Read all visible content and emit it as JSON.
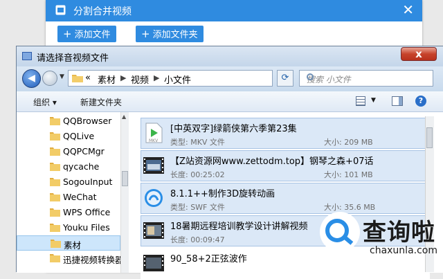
{
  "app": {
    "title": "分割合并视频",
    "close": "✕",
    "buttons": {
      "add_file": "添加文件",
      "add_folder": "添加文件夹",
      "plus": "+"
    }
  },
  "dialog": {
    "title": "请选择音视频文件",
    "close": "x",
    "nav": {
      "overflow": "«",
      "breadcrumb": [
        "素材",
        "视频",
        "小文件"
      ],
      "search_placeholder": "搜索 小文件"
    },
    "toolbar": {
      "organize": "组织 ▾",
      "new_folder": "新建文件夹",
      "help": "?"
    },
    "sidebar": {
      "items": [
        {
          "label": "QQBrowser"
        },
        {
          "label": "QQLive"
        },
        {
          "label": "QQPCMgr"
        },
        {
          "label": "qycache"
        },
        {
          "label": "SogouInput"
        },
        {
          "label": "WeChat"
        },
        {
          "label": "WPS Office"
        },
        {
          "label": "Youku Files"
        },
        {
          "label": "素材",
          "selected": true
        },
        {
          "label": "迅捷视频转换器"
        }
      ]
    },
    "files": [
      {
        "name": "[中英双字]绿箭侠第六季第23集",
        "meta": "类型: MKV 文件",
        "size": "大小: 209 MB",
        "thumb": "mkv-icon"
      },
      {
        "name": "【Z站资源网www.zettodm.top】钢琴之森+07话",
        "meta": "长度: 00:25:02",
        "size": "大小: 101 MB",
        "thumb": "video-thumbnail"
      },
      {
        "name": "8.1.1++制作3D旋转动画",
        "meta": "类型: SWF 文件",
        "size": "大小: 35.6 MB",
        "thumb": "swf-icon"
      },
      {
        "name": "18暑期远程培训教学设计讲解视频",
        "meta": "长度: 00:09:47",
        "size": "",
        "thumb": "video-thumbnail"
      },
      {
        "name": "90_58+2正弦波作",
        "meta": "",
        "size": "",
        "thumb": "video-thumbnail"
      }
    ]
  },
  "watermark": {
    "cn": "查询啦",
    "en": "chaxunla.com"
  },
  "colors": {
    "accent": "#2f8be0",
    "selection": "#dbe8f7"
  }
}
